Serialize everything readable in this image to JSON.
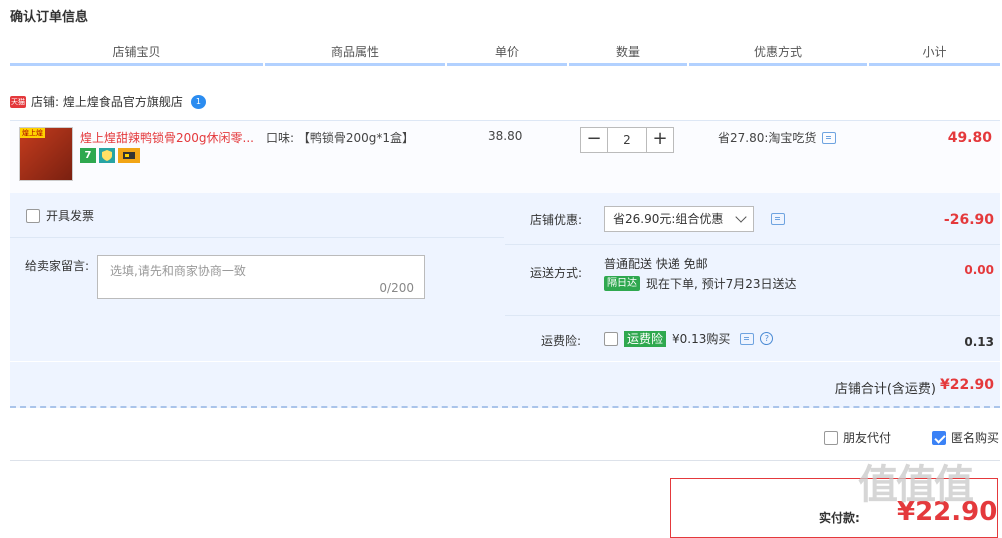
{
  "page": {
    "title": "确认订单信息"
  },
  "columns": [
    "店铺宝贝",
    "商品属性",
    "单价",
    "数量",
    "优惠方式",
    "小计"
  ],
  "shop": {
    "tmall_badge": "天猫",
    "label": "店铺: 煌上煌食品官方旗舰店",
    "ww_badge": "1"
  },
  "item": {
    "thumb_tag": "煌上煌",
    "name": "煌上煌甜辣鸭锁骨200g休闲零...",
    "attr": "口味: 【鸭锁骨200g*1盒】",
    "price": "38.80",
    "quantity": "2",
    "qty_minus": "−",
    "qty_plus": "+",
    "promo": "省27.80:淘宝吃货",
    "subtotal": "49.80",
    "badge_seven": "7"
  },
  "invoice": {
    "label": "开具发票"
  },
  "message": {
    "label": "给卖家留言:",
    "placeholder": "选填,请先和商家协商一致",
    "count": "0/200"
  },
  "shop_discount": {
    "label": "店铺优惠:",
    "selected": "省26.90元:组合优惠",
    "amount": "-26.90"
  },
  "shipping": {
    "label": "运送方式:",
    "method": "普通配送 快递 免邮",
    "badge": "隔日达",
    "eta": "现在下单, 预计7月23日送达",
    "amount": "0.00"
  },
  "insurance": {
    "label": "运费险:",
    "badge": "运费险",
    "desc": "¥0.13购买",
    "amount": "0.13"
  },
  "shop_total": {
    "label": "店铺合计(含运费)",
    "amount": "¥22.90"
  },
  "options": {
    "friend_pay": "朋友代付",
    "anonymous": "匿名购买"
  },
  "payment": {
    "label": "实付款:",
    "amount": "¥22.90"
  },
  "watermark": "值值值"
}
